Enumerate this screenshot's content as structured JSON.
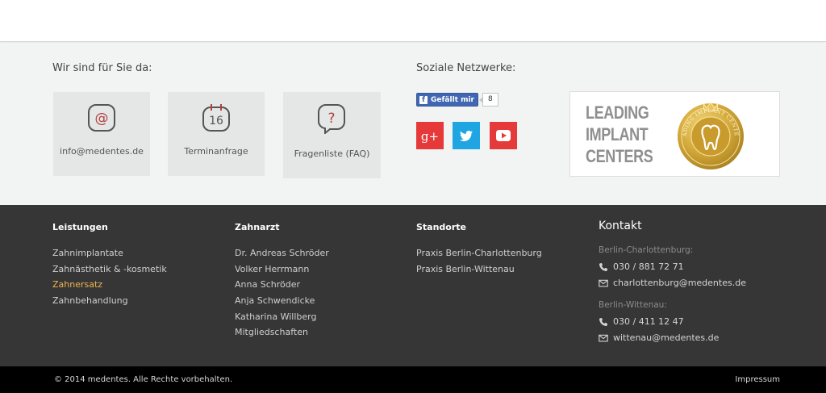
{
  "contact": {
    "title": "Wir sind für Sie da:",
    "tiles": [
      {
        "label": "info@medentes.de",
        "icon": "at-sign-icon"
      },
      {
        "label": "Terminanfrage",
        "icon": "calendar-16-icon",
        "day": "16"
      },
      {
        "label": "Fragenliste (FAQ)",
        "icon": "question-bubble-icon",
        "glyph": "?"
      }
    ]
  },
  "social": {
    "title": "Soziale Netzwerke:",
    "fb_like": {
      "label": "Gefällt mir",
      "count": "8"
    },
    "networks": [
      {
        "name": "gplus",
        "glyph": "g+",
        "color": "#e63a3a"
      },
      {
        "name": "twitter",
        "icon": "twitter-bird-icon",
        "color": "#1fa6e2"
      },
      {
        "name": "youtube",
        "icon": "youtube-play-icon",
        "color": "#e63a3a"
      }
    ]
  },
  "badge": {
    "lines": [
      "LEADING",
      "IMPLANT",
      "CENTERS"
    ],
    "seal_icon": "leading-implant-centers-seal-icon",
    "seal_text": "LEADING IMPLANT CENTERS"
  },
  "footer": {
    "columns": [
      {
        "title": "Leistungen",
        "items": [
          "Zahnimplantate",
          "Zahnästhetik & -kosmetik",
          "Zahnersatz",
          "Zahnbehandlung"
        ],
        "active_index": 2
      },
      {
        "title": "Zahnarzt",
        "items": [
          "Dr. Andreas Schröder",
          "Volker Herrmann",
          "Anna Schröder",
          "Anja Schwendicke",
          "Katharina Willberg",
          "Mitgliedschaften"
        ]
      },
      {
        "title": "Standorte",
        "items": [
          "Praxis Berlin-Charlottenburg",
          "Praxis Berlin-Wittenau"
        ]
      }
    ],
    "kontakt": {
      "title": "Kontakt",
      "locations": [
        {
          "name": "Berlin-Charlottenburg:",
          "phone": "030 / 881 72 71",
          "email": "charlottenburg@medentes.de"
        },
        {
          "name": "Berlin-Wittenau:",
          "phone": "030 / 411 12 47",
          "email": "wittenau@medentes.de"
        }
      ]
    }
  },
  "bottom": {
    "copyright": "© 2014 medentes. Alle Rechte vorbehalten.",
    "impressum": "Impressum"
  },
  "colors": {
    "accent_active_link": "#f0b34d",
    "dark_footer": "#363636",
    "band": "#f2f3f3",
    "tile": "#e5e6e6",
    "icon_red": "#b0413e",
    "gold": "#c9a227"
  }
}
